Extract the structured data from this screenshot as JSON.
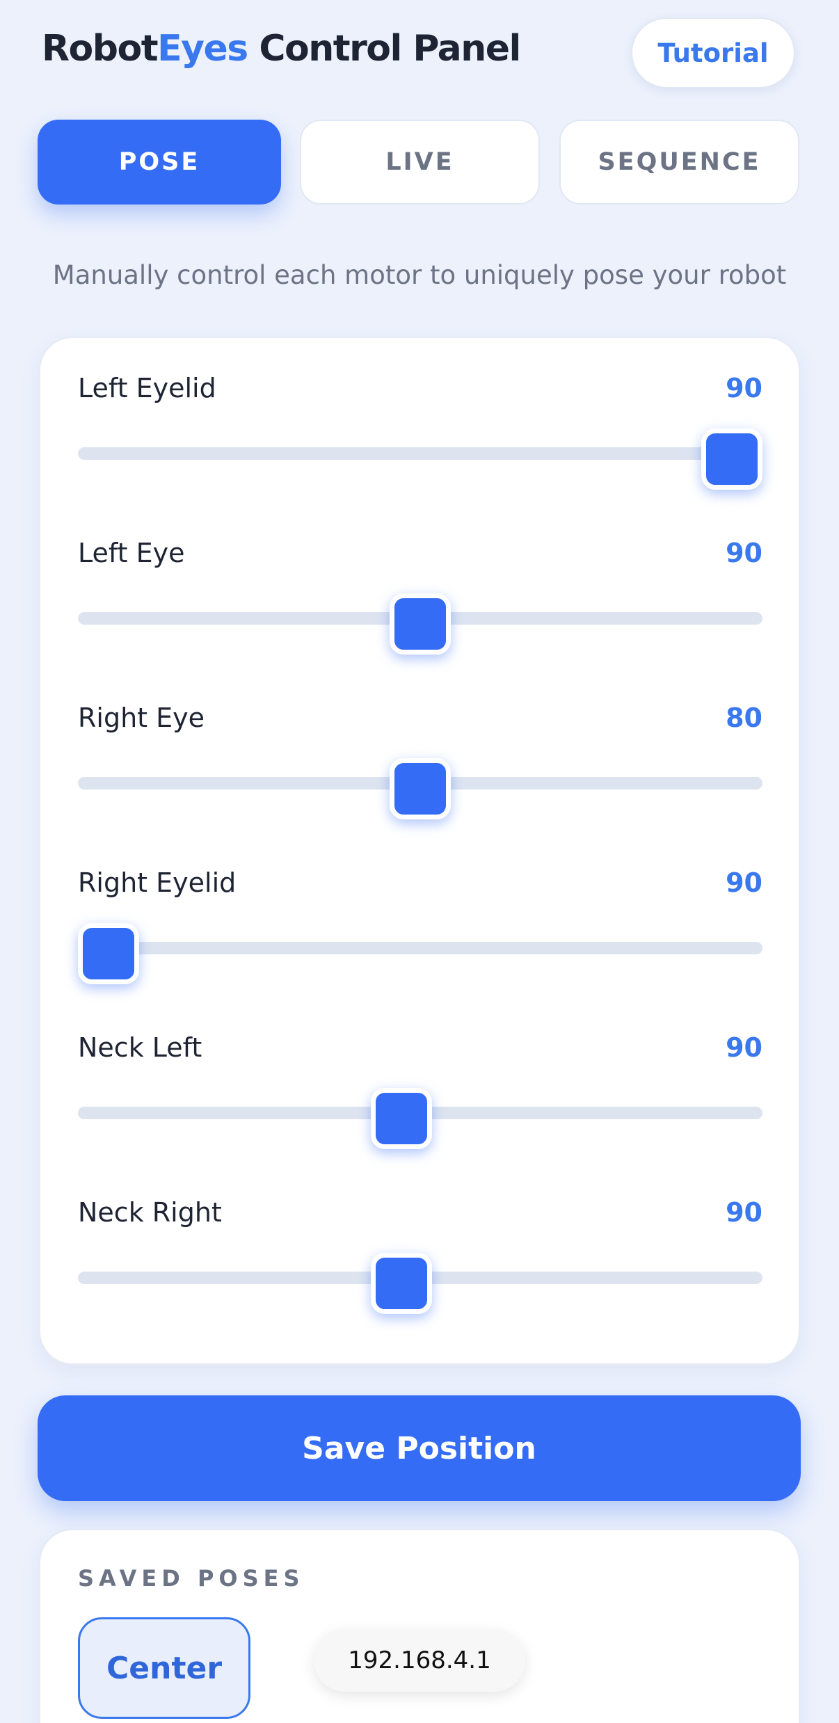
{
  "header": {
    "title_part1": "Robot",
    "title_accent": "Eyes",
    "title_part2": " Control Panel",
    "tutorial_label": "Tutorial"
  },
  "tabs": [
    {
      "label": "POSE",
      "active": true
    },
    {
      "label": "LIVE",
      "active": false
    },
    {
      "label": "SEQUENCE",
      "active": false
    }
  ],
  "subtitle": "Manually control each motor to uniquely pose your robot",
  "sliders": [
    {
      "label": "Left Eyelid",
      "value": "90",
      "position": 1.0
    },
    {
      "label": "Left Eye",
      "value": "90",
      "position": 0.5
    },
    {
      "label": "Right Eye",
      "value": "80",
      "position": 0.5
    },
    {
      "label": "Right Eyelid",
      "value": "90",
      "position": 0.0
    },
    {
      "label": "Neck Left",
      "value": "90",
      "position": 0.47
    },
    {
      "label": "Neck Right",
      "value": "90",
      "position": 0.47
    }
  ],
  "save_label": "Save Position",
  "saved_poses": {
    "heading": "SAVED POSES",
    "items": [
      {
        "label": "Center"
      }
    ]
  },
  "ip_address": "192.168.4.1",
  "colors": {
    "accent": "#356cf6",
    "accent_text": "#3a78ee",
    "background": "#ecf1fc"
  }
}
